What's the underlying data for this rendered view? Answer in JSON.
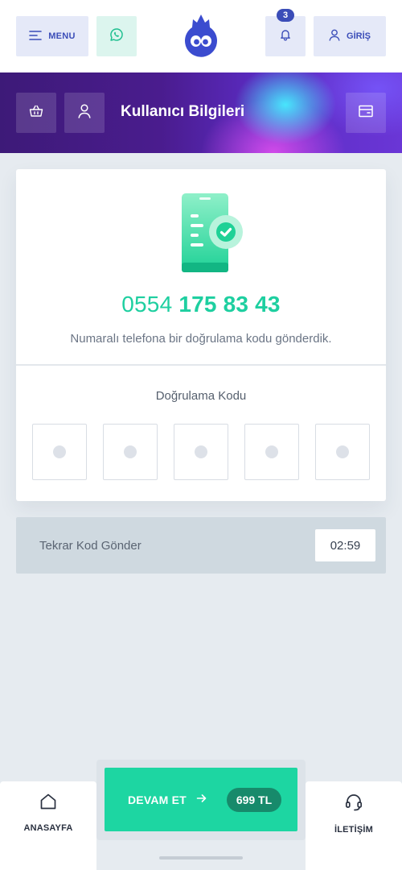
{
  "header": {
    "menu_label": "MENU",
    "notification_count": "3",
    "login_label": "GİRİŞ"
  },
  "hero": {
    "title": "Kullanıcı Bilgileri"
  },
  "verification": {
    "phone_prefix": "0554",
    "phone_rest": "175 83 43",
    "info": "Numaralı telefona bir doğrulama kodu gönderdik.",
    "code_label": "Doğrulama Kodu",
    "code_digits": 5
  },
  "resend": {
    "label": "Tekrar Kod Gönder",
    "timer": "02:59"
  },
  "bottom_bar": {
    "home_label": "ANASAYFA",
    "cta_label": "DEVAM ET",
    "price": "699 TL",
    "contact_label": "İLETİŞİM"
  },
  "colors": {
    "accent_blue": "#3b4db8",
    "accent_green": "#1dd6a2",
    "price_pill": "#178a6b",
    "background": "#e6ebf0"
  },
  "icons": [
    "menu-icon",
    "whatsapp-icon",
    "logo-mascot",
    "bell-icon",
    "user-icon",
    "basket-icon",
    "wallet-icon",
    "home-icon",
    "headset-icon",
    "arrow-right-icon"
  ]
}
